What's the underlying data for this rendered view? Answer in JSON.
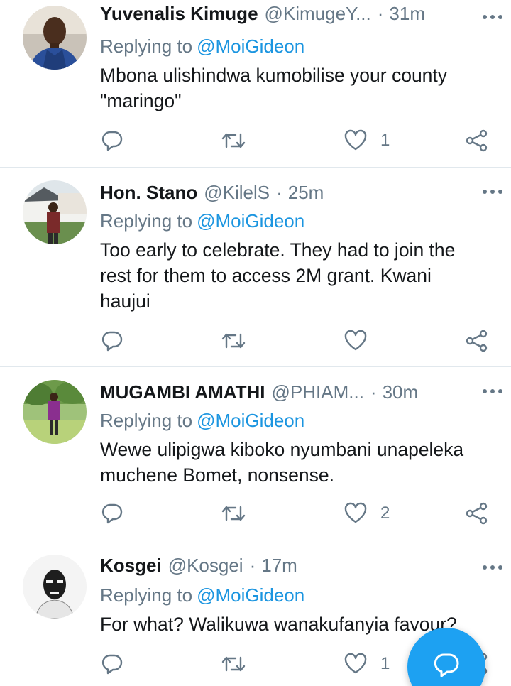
{
  "tweets": [
    {
      "name": "Yuvenalis Kimuge",
      "handle": "@KimugeY...",
      "separator": "·",
      "time": "31m",
      "replying_label": "Replying to",
      "replying_to": "@MoiGideon",
      "text_lines": [
        "Mbona ulishindwa kumobilise your county",
        "\"maringo\""
      ],
      "like_count": "1",
      "avatar_icon": "avatar-man-blue-shirt"
    },
    {
      "name": "Hon. Stano",
      "handle": "@KilelS",
      "separator": "·",
      "time": "25m",
      "replying_label": "Replying to",
      "replying_to": "@MoiGideon",
      "text_lines": [
        "Too early to celebrate. They had to join the",
        "rest for them to access 2M grant. Kwani",
        "haujui"
      ],
      "like_count": "",
      "avatar_icon": "avatar-man-house"
    },
    {
      "name": "MUGAMBI AMATHI",
      "handle": "@PHIAM...",
      "separator": "·",
      "time": "30m",
      "replying_label": "Replying to",
      "replying_to": "@MoiGideon",
      "text_lines": [
        "Wewe ulipigwa kiboko nyumbani unapeleka",
        "muchene Bomet, nonsense."
      ],
      "like_count": "2",
      "avatar_icon": "avatar-man-field"
    },
    {
      "name": "Kosgei",
      "handle": "@Kosgei",
      "separator": "·",
      "time": "17m",
      "replying_label": "Replying to",
      "replying_to": "@MoiGideon",
      "text_lines": [
        "For what? Walikuwa wanakufanyia favour?"
      ],
      "like_count": "1",
      "avatar_icon": "avatar-sketch-face"
    }
  ],
  "colors": {
    "link": "#1b95e0",
    "muted": "#657786",
    "text": "#14171a",
    "fab": "#1da1f2",
    "divider": "#e1e8ed"
  },
  "icons": {
    "reply": "reply-icon",
    "retweet": "retweet-icon",
    "like": "heart-icon",
    "share": "share-icon",
    "more": "more-dots-icon",
    "compose": "compose-reply-icon"
  }
}
